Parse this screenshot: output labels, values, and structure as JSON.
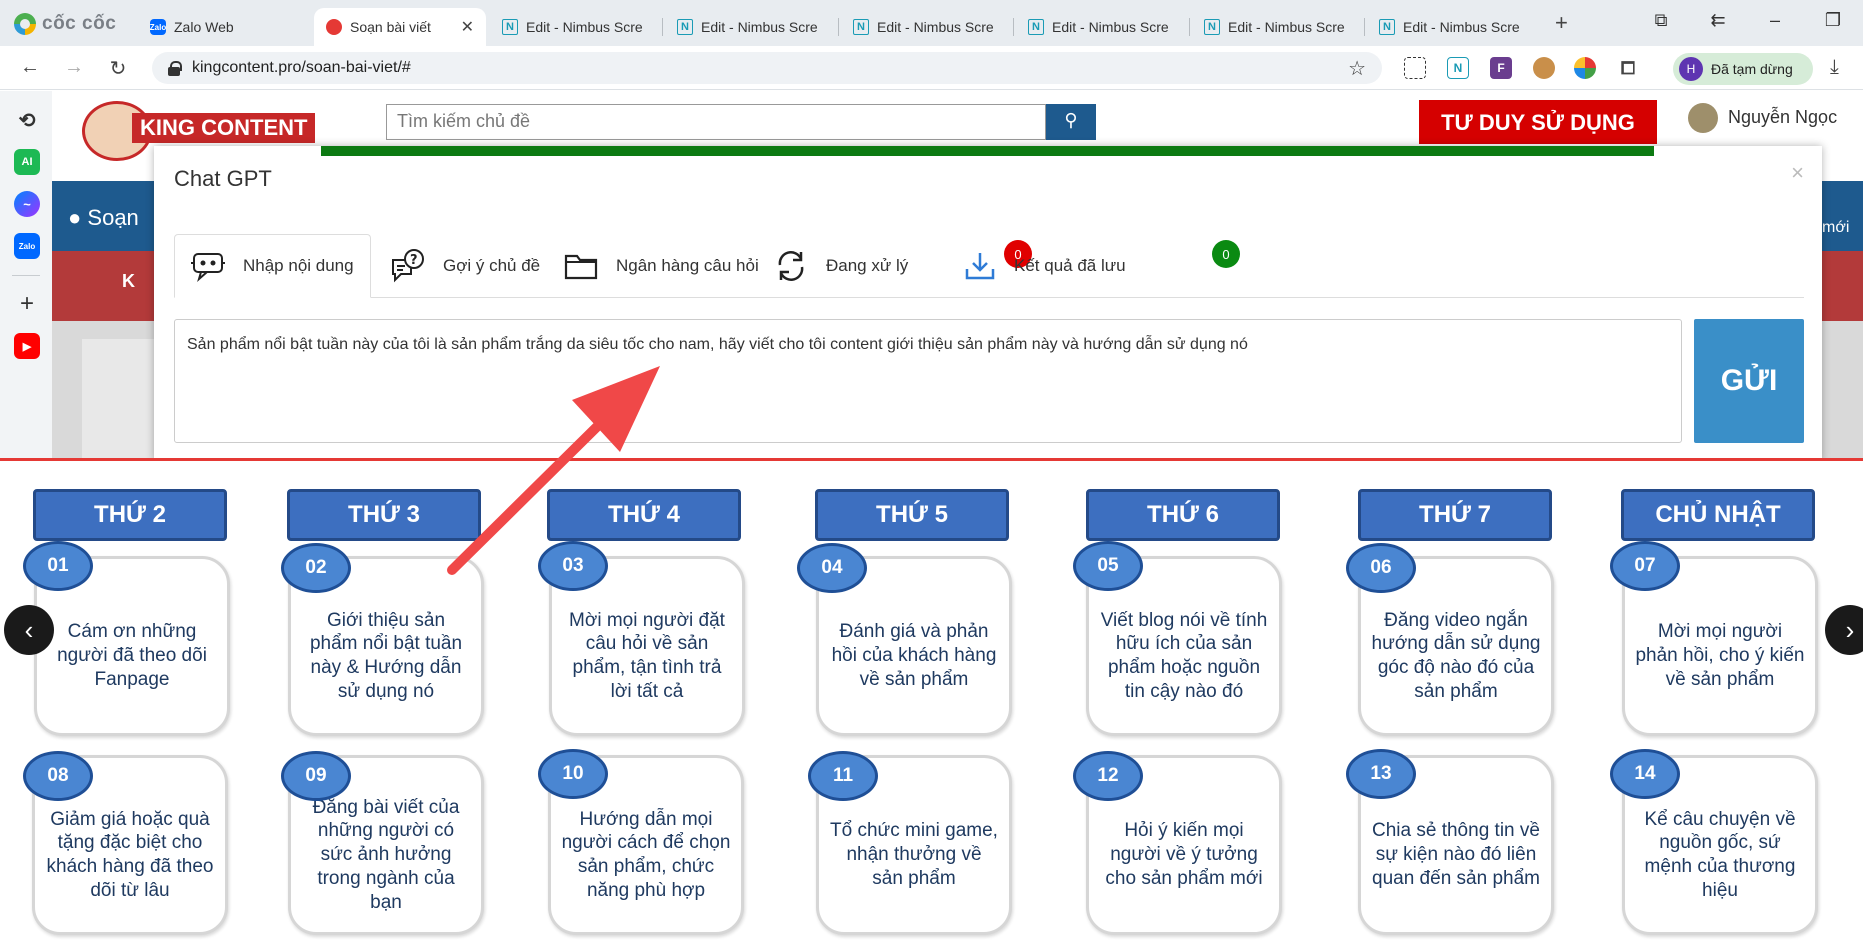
{
  "browser": {
    "brand": "cốc cốc",
    "tabs": [
      {
        "title": "Zalo Web",
        "icon": "zalo-icon"
      },
      {
        "title": "Soạn bài viết",
        "icon": "king-icon",
        "active": true
      },
      {
        "title": "Edit - Nimbus Scre",
        "icon": "nimbus-icon"
      },
      {
        "title": "Edit - Nimbus Scre",
        "icon": "nimbus-icon"
      },
      {
        "title": "Edit - Nimbus Scre",
        "icon": "nimbus-icon"
      },
      {
        "title": "Edit - Nimbus Scre",
        "icon": "nimbus-icon"
      },
      {
        "title": "Edit - Nimbus Scre",
        "icon": "nimbus-icon"
      },
      {
        "title": "Edit - Nimbus Scre",
        "icon": "nimbus-icon"
      }
    ],
    "url": "kingcontent.pro/soan-bai-viet/#",
    "profile_initial": "H",
    "profile_status": "Đã tạm dừng",
    "extensions": [
      "N",
      "F"
    ]
  },
  "site": {
    "logo_text": "KING CONTENT",
    "search_placeholder": "Tìm kiếm chủ đề",
    "cta": "TƯ DUY SỬ DỤNG",
    "user": "Nguyễn Ngọc",
    "nav_label": "Soạn",
    "nav_right": "mới",
    "nav_red": "K"
  },
  "modal": {
    "title": "Chat GPT",
    "close": "×",
    "tabs": [
      {
        "label": "Nhập nội dung",
        "icon": "chatbot-icon"
      },
      {
        "label": "Gợi ý chủ đề",
        "icon": "question-chat-icon"
      },
      {
        "label": "Ngân hàng câu hỏi",
        "icon": "folder-icon"
      },
      {
        "label": "Đang xử lý",
        "icon": "refresh-icon",
        "badge": "0"
      },
      {
        "label": "Kết quả đã lưu",
        "icon": "download-icon",
        "badge": "0"
      }
    ],
    "input_text": "Sản phẩm nổi bật tuần này của tôi là sản phẩm trắng da siêu tốc cho nam, hãy viết cho tôi content giới thiệu sản phẩm này và hướng dẫn sử dụng nó",
    "send_label": "GỬI"
  },
  "calendar": {
    "days": [
      "THỨ 2",
      "THỨ 3",
      "THỨ 4",
      "THỨ 5",
      "THỨ 6",
      "THỨ 7",
      "CHỦ NHẬT"
    ],
    "week1": [
      {
        "num": "01",
        "text": "Cám ơn những người đã theo dõi Fanpage"
      },
      {
        "num": "02",
        "text": "Giới thiệu sản phẩm nổi bật tuần này & Hướng dẫn sử dụng nó"
      },
      {
        "num": "03",
        "text": "Mời mọi người đặt câu hỏi về sản phẩm, tận tình trả lời tất cả"
      },
      {
        "num": "04",
        "text": "Đánh giá và phản hồi của khách hàng về sản phẩm"
      },
      {
        "num": "05",
        "text": "Viết blog nói về tính hữu ích của sản phẩm hoặc nguồn tin cậy nào đó"
      },
      {
        "num": "06",
        "text": "Đăng video ngắn hướng dẫn sử dụng góc độ nào đó của sản phẩm"
      },
      {
        "num": "07",
        "text": "Mời mọi người phản hồi, cho ý kiến về sản phẩm"
      }
    ],
    "week2": [
      {
        "num": "08",
        "text": "Giảm giá hoặc quà tặng đặc biệt cho khách hàng đã theo dõi từ lâu"
      },
      {
        "num": "09",
        "text": "Đăng bài viết của những người có sức ảnh hưởng trong ngành của bạn"
      },
      {
        "num": "10",
        "text": "Hướng dẫn mọi người cách để chọn sản phẩm, chức năng phù hợp"
      },
      {
        "num": "11",
        "text": "Tổ chức mini game, nhận thưởng về sản phẩm"
      },
      {
        "num": "12",
        "text": "Hỏi ý kiến mọi người về ý tưởng cho sản phẩm mới"
      },
      {
        "num": "13",
        "text": "Chia sẻ thông tin về sự kiện nào đó liên quan đến sản phẩm"
      },
      {
        "num": "14",
        "text": "Kể câu chuyện về nguồn gốc, sứ mệnh của thương hiệu"
      }
    ],
    "prev": "‹",
    "next": "›"
  },
  "colors": {
    "day_header": "#3d6fc0",
    "number_bubble": "#4a86d2",
    "send_button": "#3a8fc8",
    "progress": "#0c7a12",
    "badge_red": "#e00000",
    "badge_green": "#0a8a12",
    "annotation_arrow": "#f04848"
  }
}
